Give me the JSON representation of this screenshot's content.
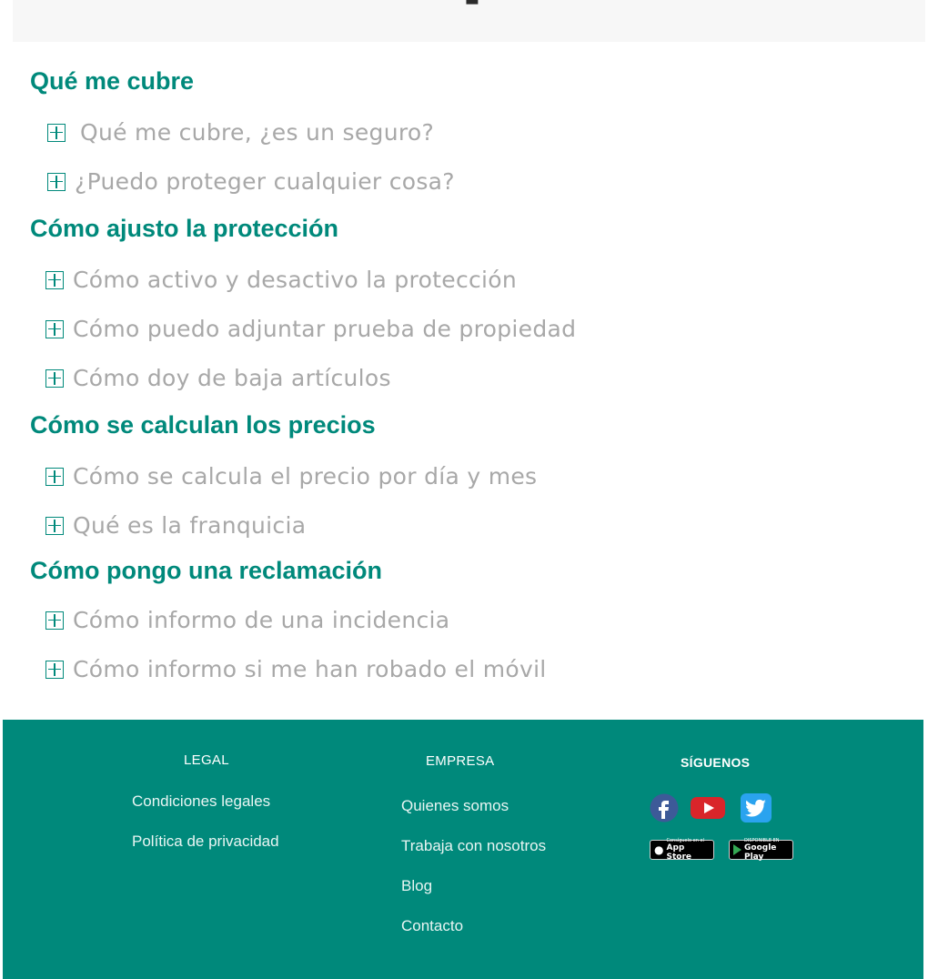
{
  "faq": {
    "sections": [
      {
        "title": "Qué me cubre",
        "questions": [
          "Qué me cubre, ¿es un seguro?",
          "¿Puedo proteger cualquier cosa?"
        ]
      },
      {
        "title": "Cómo ajusto la protección",
        "questions": [
          "Cómo activo y desactivo la protección",
          "Cómo puedo adjuntar prueba de propiedad",
          "Cómo doy de baja artículos"
        ]
      },
      {
        "title": "Cómo se calculan los precios",
        "questions": [
          "Cómo se calcula el precio por día y mes",
          "Qué es la franquicia"
        ]
      },
      {
        "title": "Cómo pongo una reclamación",
        "questions": [
          "Cómo informo de una incidencia",
          "Cómo informo si me han robado el móvil"
        ]
      }
    ]
  },
  "footer": {
    "legal": {
      "title": "LEGAL",
      "links": [
        "Condiciones legales",
        "Política de privacidad"
      ]
    },
    "empresa": {
      "title": "EMPRESA",
      "links": [
        "Quienes somos",
        "Trabaja con nosotros",
        "Blog",
        "Contacto"
      ]
    },
    "siguenos": {
      "title": "SÍGUENOS",
      "social": [
        "facebook-icon",
        "youtube-icon",
        "twitter-icon"
      ],
      "badges": {
        "app_store": {
          "small": "Consíguelo en el",
          "big": "App Store"
        },
        "google_play": {
          "small": "DISPONIBLE EN",
          "big": "Google Play"
        }
      }
    }
  },
  "colors": {
    "accent": "#00897b",
    "question_text": "#a8a8a8",
    "footer_bg": "#00897b"
  }
}
